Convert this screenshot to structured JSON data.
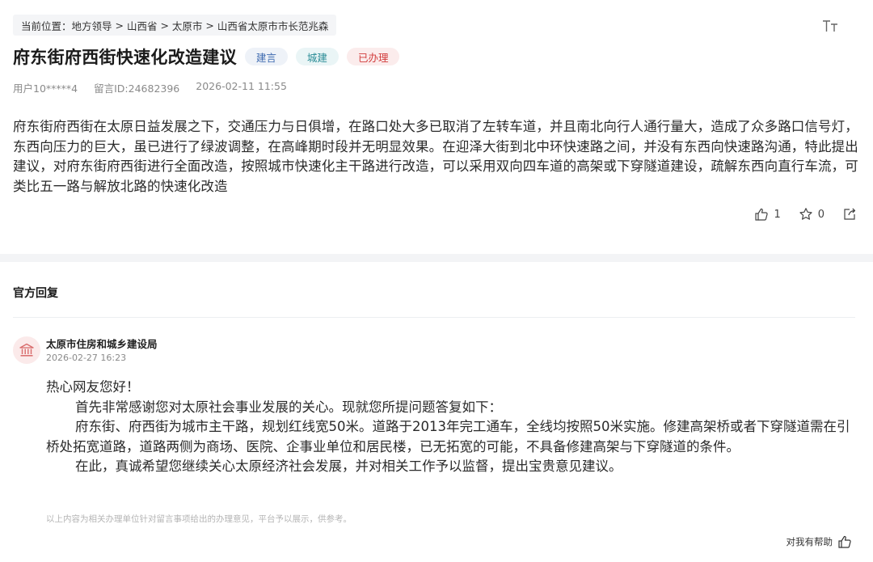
{
  "breadcrumb": {
    "prefix": "当前位置：",
    "items": [
      "地方领导",
      "山西省",
      "太原市",
      "山西省太原市市长范兆森"
    ],
    "separator": " > "
  },
  "header": {
    "font_size_icon": "text-size-icon",
    "title": "府东街府西街快速化改造建议",
    "tags": [
      {
        "label": "建言",
        "color": "#3f6bb0"
      },
      {
        "label": "城建",
        "color": "#2a8c96"
      },
      {
        "label": "已办理",
        "color": "#d23c3c"
      }
    ]
  },
  "meta": {
    "user": "用户10*****4",
    "message_id": "留言ID:24682396",
    "datetime": "2026-02-11 11:55"
  },
  "question": {
    "body": "府东街府西街在太原日益发展之下，交通压力与日俱增，在路口处大多已取消了左转车道，并且南北向行人通行量大，造成了众多路口信号灯，东西向压力的巨大，虽已进行了绿波调整，在高峰期时段并无明显效果。在迎泽大街到北中环快速路之间，并没有东西向快速路沟通，特此提出建议，对府东街府西街进行全面改造，按照城市快速化主干路进行改造，可以采用双向四车道的高架或下穿隧道建设，疏解东西向直行车流，可类比五一路与解放北路的快速化改造"
  },
  "actions": {
    "like_count": "1",
    "favorite_count": "0",
    "like_icon": "thumbs-up-icon",
    "favorite_icon": "star-icon",
    "share_icon": "share-icon"
  },
  "reply_section": {
    "title": "官方回复",
    "org_name": "太原市住房和城乡建设局",
    "org_icon": "government-building-icon",
    "date": "2026-02-27 16:23",
    "greeting": "热心网友您好！",
    "paragraphs": [
      "首先非常感谢您对太原社会事业发展的关心。现就您所提问题答复如下：",
      "府东街、府西街为城市主干路，规划红线宽50米。道路于2013年完工通车，全线均按照50米实施。修建高架桥或者下穿隧道需在引桥处拓宽道路，道路两侧为商场、医院、企事业单位和居民楼，已无拓宽的可能，不具备修建高架与下穿隧道的条件。",
      "在此，真诚希望您继续关心太原经济社会发展，并对相关工作予以监督，提出宝贵意见建议。"
    ],
    "disclaimer": "以上内容为相关办理单位针对留言事项给出的办理意见，平台予以展示，供参考。",
    "helpful_label": "对我有帮助",
    "accent_color": "#d23c3c"
  }
}
